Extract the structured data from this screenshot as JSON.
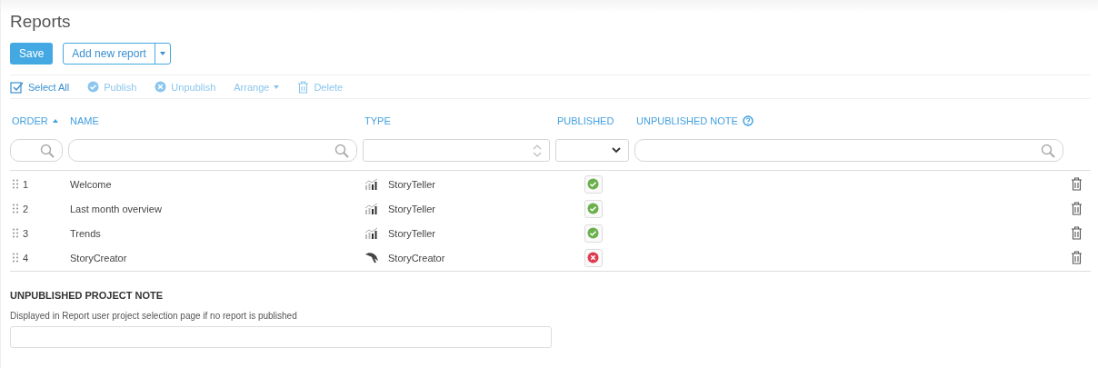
{
  "title": "Reports",
  "actions": {
    "save": "Save",
    "add": "Add new report"
  },
  "toolbar": [
    {
      "kind": "select",
      "label": "Select All",
      "disabled": false
    },
    {
      "kind": "publish",
      "label": "Publish",
      "disabled": true
    },
    {
      "kind": "unpublish",
      "label": "Unpublish",
      "disabled": true
    },
    {
      "kind": "arrange",
      "label": "Arrange",
      "disabled": true
    },
    {
      "kind": "delete",
      "label": "Delete",
      "disabled": true
    }
  ],
  "columns": [
    {
      "label": "ORDER",
      "sorted": true,
      "help": false,
      "kind": "search"
    },
    {
      "label": "NAME",
      "sorted": false,
      "help": false,
      "kind": "search"
    },
    {
      "label": "TYPE",
      "sorted": false,
      "help": false,
      "kind": "spinner"
    },
    {
      "label": "PUBLISHED",
      "sorted": false,
      "help": false,
      "kind": "select"
    },
    {
      "label": "UNPUBLISHED NOTE",
      "sorted": false,
      "help": true,
      "kind": "search"
    }
  ],
  "rows": [
    {
      "order": "1",
      "name": "Welcome",
      "kind": "storyteller",
      "type": "StoryTeller",
      "published": true
    },
    {
      "order": "2",
      "name": "Last month overview",
      "kind": "storyteller",
      "type": "StoryTeller",
      "published": true
    },
    {
      "order": "3",
      "name": "Trends",
      "kind": "storyteller",
      "type": "StoryTeller",
      "published": true
    },
    {
      "order": "4",
      "name": "StoryCreator",
      "kind": "storycreator",
      "type": "StoryCreator",
      "published": false
    }
  ],
  "project_note": {
    "heading": "UNPUBLISHED PROJECT NOTE",
    "description": "Displayed in Report user project selection page if no report is published"
  }
}
